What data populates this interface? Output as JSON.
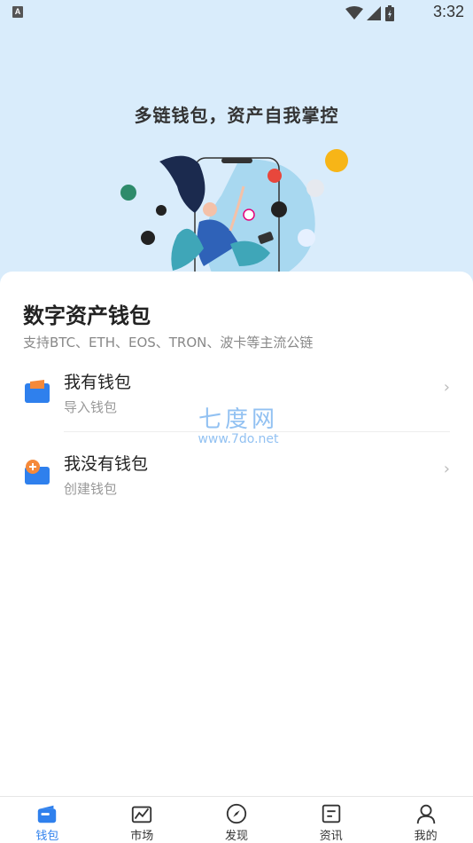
{
  "status_bar": {
    "badge": "A",
    "time": "3:32"
  },
  "hero": {
    "title": "多链钱包，资产自我掌控"
  },
  "card": {
    "title": "数字资产钱包",
    "subtitle": "支持BTC、ETH、EOS、TRON、波卡等主流公链",
    "options": [
      {
        "title": "我有钱包",
        "subtitle": "导入钱包",
        "icon": "import-wallet-icon"
      },
      {
        "title": "我没有钱包",
        "subtitle": "创建钱包",
        "icon": "create-wallet-icon"
      }
    ]
  },
  "watermark": {
    "main": "七度网",
    "url": "www.7do.net"
  },
  "tabbar": {
    "tabs": [
      {
        "label": "钱包",
        "icon": "wallet-icon",
        "active": true
      },
      {
        "label": "市场",
        "icon": "market-chart-icon"
      },
      {
        "label": "发现",
        "icon": "compass-icon"
      },
      {
        "label": "资讯",
        "icon": "news-icon"
      },
      {
        "label": "我的",
        "icon": "profile-icon"
      }
    ]
  },
  "colors": {
    "accent": "#2f80ed",
    "hero_bg": "#d9ecfb",
    "option_orange": "#f5893a"
  }
}
